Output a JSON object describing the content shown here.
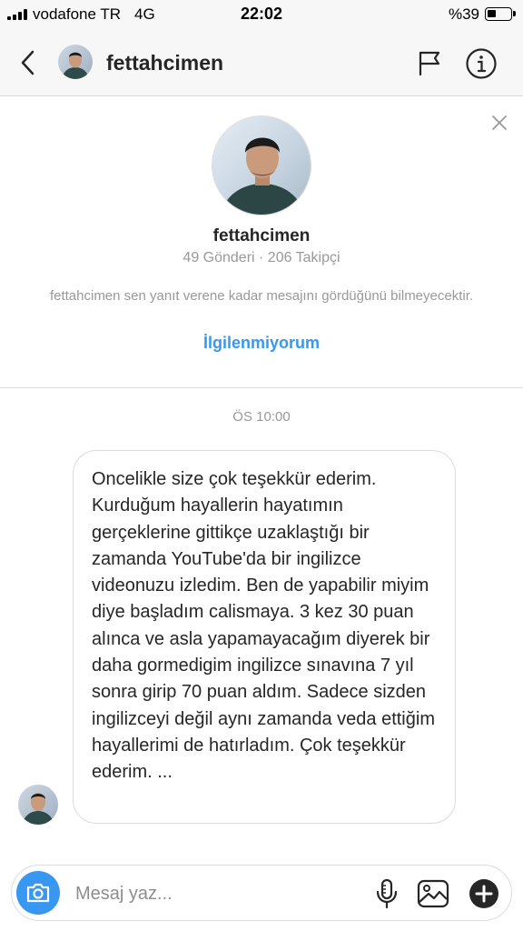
{
  "status_bar": {
    "carrier": "vodafone TR",
    "network": "4G",
    "time": "22:02",
    "battery": "%39",
    "battery_level": 0.39
  },
  "header": {
    "username": "fettahcimen",
    "avatar_icon": "profile-photo",
    "back_icon": "chevron-left-icon",
    "flag_icon": "flag-icon",
    "info_icon": "info-icon"
  },
  "profile_card": {
    "name": "fettahcimen",
    "stats": "49 Gönderi · 206 Takipçi",
    "note": "fettahcimen sen yanıt verene kadar mesajını gördüğünü bilmeyecektir.",
    "action": "İlgilenmiyorum",
    "close_icon": "close-icon"
  },
  "conversation": {
    "timestamp": "ÖS 10:00",
    "message": "Oncelikle size çok teşekkür ederim. Kurduğum hayallerin hayatımın gerçeklerine gittikçe uzaklaştığı bir zamanda YouTube'da bir ingilizce videonuzu izledim. Ben de yapabilir miyim diye başladım calismaya. 3 kez 30 puan alınca ve asla yapamayacağım diyerek bir daha gormedigim ingilizce sınavına 7 yıl sonra girip 70 puan aldım. Sadece sizden ingilizceyi değil aynı zamanda veda ettiğim hayallerimi de hatırladım. Çok teşekkür ederim. ..."
  },
  "composer": {
    "placeholder": "Mesaj yaz...",
    "camera_icon": "camera-icon",
    "mic_icon": "microphone-icon",
    "gallery_icon": "image-icon",
    "plus_icon": "plus-circle-icon"
  },
  "colors": {
    "accent": "#3897f0",
    "text": "#262626",
    "muted": "#999999",
    "border": "#dbdbdb",
    "header_bg": "#f7f7f7"
  }
}
